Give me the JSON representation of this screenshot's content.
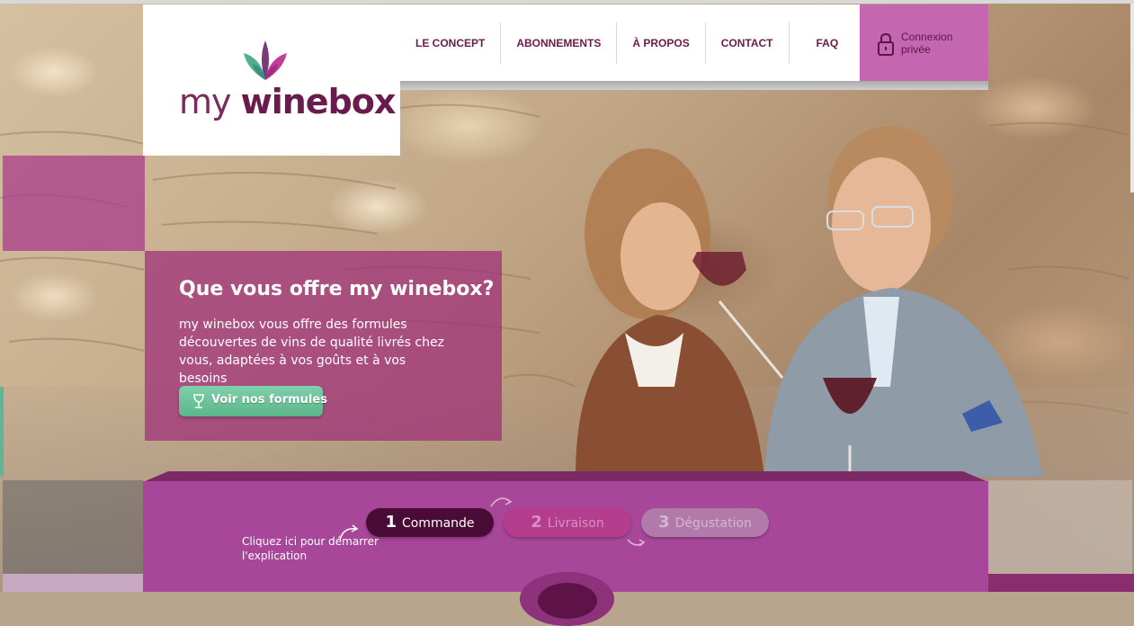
{
  "brand": {
    "logo_my": "my",
    "logo_wb": "winebox",
    "colors": {
      "primary": "#6a1b4d",
      "accent": "#c466b0",
      "green": "#5cb68c",
      "band": "#a8479a"
    }
  },
  "nav": {
    "items": [
      {
        "label": "LE CONCEPT"
      },
      {
        "label": "ABONNEMENTS"
      },
      {
        "label": "À PROPOS"
      },
      {
        "label": "CONTACT"
      },
      {
        "label": "FAQ"
      }
    ],
    "login_label": "Connexion privée",
    "login_icon": "lock-icon"
  },
  "hero": {
    "title": "Que vous offre my winebox?",
    "body": "my winebox vous offre des formules découvertes de vins de qualité livrés chez vous, adaptées à vos goûts et à vos besoins",
    "button_label": "Voir nos formules",
    "button_icon": "wine-glass-icon"
  },
  "steps": {
    "hint": "Cliquez ici pour démarrer l'explication",
    "items": [
      {
        "num": "1",
        "label": "Commande"
      },
      {
        "num": "2",
        "label": "Livraison"
      },
      {
        "num": "3",
        "label": "Dégustation"
      }
    ]
  }
}
